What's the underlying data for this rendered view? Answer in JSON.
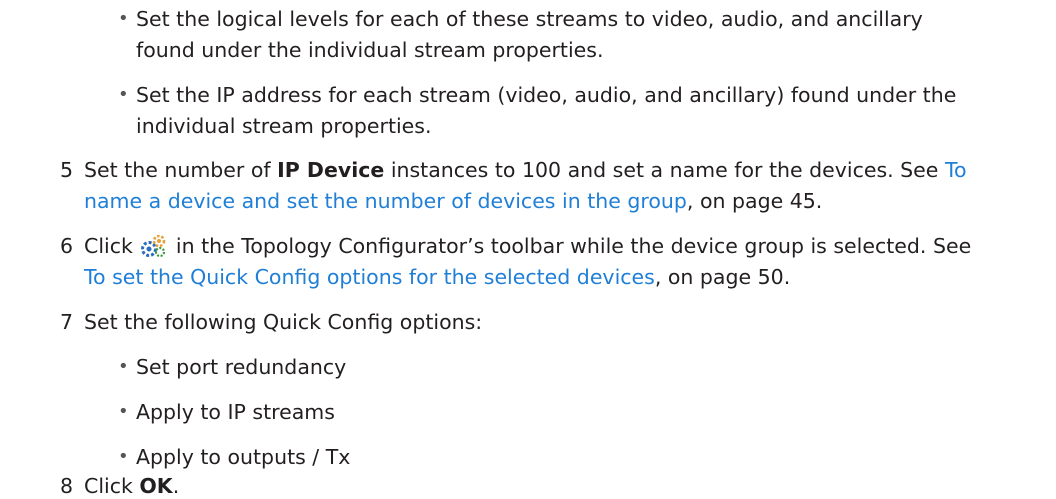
{
  "bullets_a": [
    {
      "line1": "Set the logical levels for each of these streams to video, audio, and ancillary",
      "line2": "found under the individual stream properties."
    },
    {
      "line1": "Set the IP address for each stream (video, audio, and ancillary) found under the",
      "line2": "individual stream properties."
    }
  ],
  "step5": {
    "num": "5",
    "pre": "Set the number of ",
    "bold": "IP Device",
    "mid": " instances to 100 and set a name for the devices. See ",
    "link1": "To",
    "link2": "name a device and set the number of devices in the group",
    "post": ", on page 45."
  },
  "step6": {
    "num": "6",
    "pre": "Click",
    "icon": "quick-config-gears-icon",
    "mid": "in the Topology Configurator’s toolbar while the device group is selected. See",
    "link": "To set the Quick Config options for the selected devices",
    "post": ", on page 50."
  },
  "step7": {
    "num": "7",
    "text": "Set the following Quick Config options:",
    "options": [
      "Set port redundancy",
      "Apply to IP streams",
      "Apply to outputs / Tx"
    ]
  },
  "step8": {
    "num": "8",
    "pre": "Click ",
    "bold": "OK",
    "post": "."
  },
  "colors": {
    "link": "#1f7fd6",
    "text": "#231f20"
  }
}
